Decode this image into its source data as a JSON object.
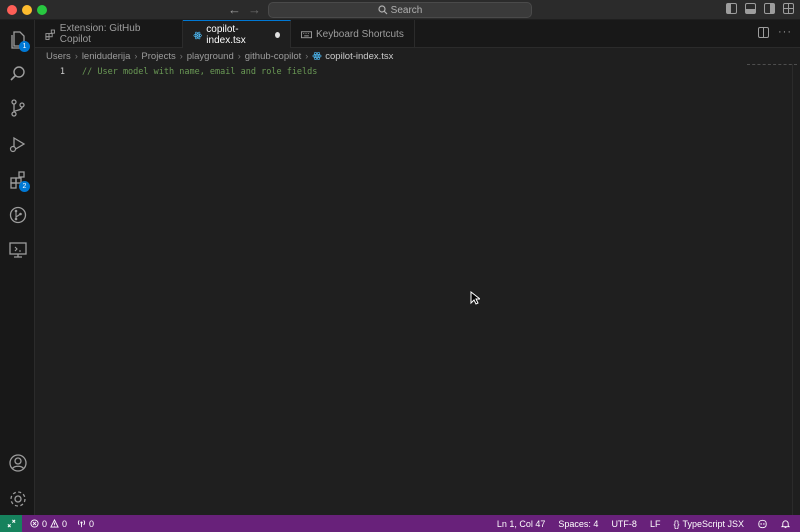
{
  "window": {
    "search_label": "Search",
    "nav_back": "←",
    "nav_forward": "→"
  },
  "activity_bar": {
    "items": [
      {
        "name": "explorer",
        "badge": "1"
      },
      {
        "name": "search"
      },
      {
        "name": "source-control"
      },
      {
        "name": "run-debug"
      },
      {
        "name": "extensions",
        "badge": "2"
      },
      {
        "name": "git-graph"
      },
      {
        "name": "remote-explorer"
      }
    ],
    "bottom": [
      "accounts",
      "manage"
    ]
  },
  "tabs": [
    {
      "label": "Extension: GitHub Copilot",
      "active": false
    },
    {
      "label": "copilot-index.tsx",
      "active": true,
      "dirty": true
    },
    {
      "label": "Keyboard Shortcuts",
      "active": false
    }
  ],
  "breadcrumb": {
    "parts": [
      "Users",
      "leniduderija",
      "Projects",
      "playground",
      "github-copilot"
    ],
    "file": "copilot-index.tsx"
  },
  "editor": {
    "lines": [
      {
        "number": "1",
        "text": "// User model with name, email and role fields"
      }
    ]
  },
  "status_bar": {
    "errors": "0",
    "warnings": "0",
    "ports": "0",
    "position": "Ln 1, Col 47",
    "spaces": "Spaces: 4",
    "encoding": "UTF-8",
    "eol": "LF",
    "language": "TypeScript JSX"
  },
  "colors": {
    "status_bar": "#68217a",
    "remote": "#16825d",
    "accent": "#0078d4",
    "comment": "#6a9955"
  }
}
